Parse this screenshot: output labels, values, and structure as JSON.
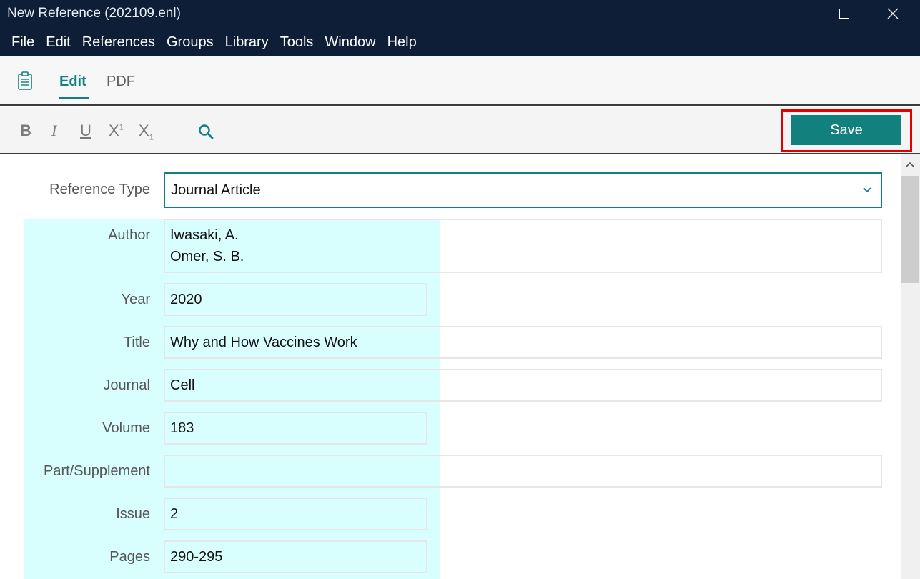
{
  "window": {
    "title": "New Reference (202109.enl)"
  },
  "menu": [
    "File",
    "Edit",
    "References",
    "Groups",
    "Library",
    "Tools",
    "Window",
    "Help"
  ],
  "tabs": {
    "edit": "Edit",
    "pdf": "PDF"
  },
  "toolbar": {
    "bold": "B",
    "italic": "I",
    "underline": "U",
    "superscript": "X",
    "superscript_mark": "1",
    "subscript": "X",
    "subscript_mark": "1",
    "save_label": "Save"
  },
  "colors": {
    "accent": "#12807d",
    "titlebar": "#0d1e36",
    "highlight": "#d8fefe",
    "save_outline": "#e00000"
  },
  "icons": {
    "tab_icon": "clipboard-icon",
    "search": "search-icon",
    "dropdown": "chevron-down-icon"
  },
  "form": {
    "reference_type": {
      "label": "Reference Type",
      "value": "Journal Article"
    },
    "fields": [
      {
        "label": "Author",
        "lines": [
          "Iwasaki, A.",
          "Omer, S. B."
        ]
      },
      {
        "label": "Year",
        "value": "2020"
      },
      {
        "label": "Title",
        "value": "Why and How Vaccines Work"
      },
      {
        "label": "Journal",
        "value": "Cell"
      },
      {
        "label": "Volume",
        "value": "183"
      },
      {
        "label": "Part/Supplement",
        "value": ""
      },
      {
        "label": "Issue",
        "value": "2"
      },
      {
        "label": "Pages",
        "value": "290-295"
      }
    ]
  }
}
